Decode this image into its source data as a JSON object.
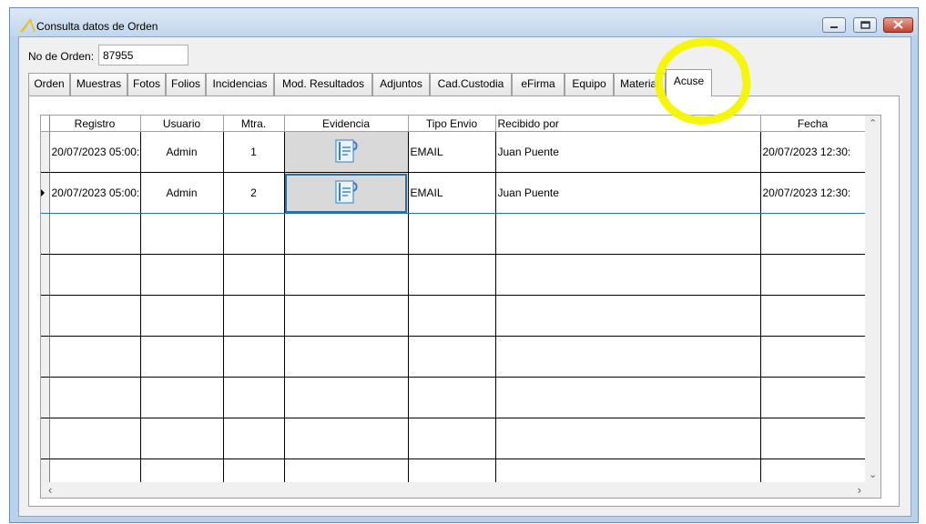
{
  "window": {
    "title": "Consulta datos de Orden",
    "icons": {
      "app": "app-logo-icon",
      "minimize": "minimize-icon",
      "maximize": "maximize-icon",
      "close": "close-icon"
    },
    "colors": {
      "highlight": "#f6f600",
      "selection": "#2a6fa8",
      "close_button": "#c14531"
    }
  },
  "order": {
    "label": "No de Orden:",
    "value": "87955"
  },
  "tabs": [
    {
      "label": "Orden"
    },
    {
      "label": "Muestras"
    },
    {
      "label": "Fotos"
    },
    {
      "label": "Folios"
    },
    {
      "label": "Incidencias"
    },
    {
      "label": "Mod. Resultados"
    },
    {
      "label": "Adjuntos"
    },
    {
      "label": "Cad.Custodia"
    },
    {
      "label": "eFirma"
    },
    {
      "label": "Equipo"
    },
    {
      "label": "Material"
    },
    {
      "label": "Acuse",
      "active": true
    }
  ],
  "grid": {
    "columns": [
      "Registro",
      "Usuario",
      "Mtra.",
      "Evidencia",
      "Tipo Envio",
      "Recibido por",
      "Fecha"
    ],
    "rows": [
      {
        "registro": "20/07/2023 05:00:",
        "usuario": "Admin",
        "mtra": "1",
        "evidencia_icon": "document-evidence-icon",
        "tipo_envio": "EMAIL",
        "recibido_por": "Juan Puente",
        "fecha": "20/07/2023 12:30:"
      },
      {
        "registro": "20/07/2023 05:00:",
        "usuario": "Admin",
        "mtra": "2",
        "evidencia_icon": "document-evidence-icon",
        "tipo_envio": "EMAIL",
        "recibido_por": "Juan Puente",
        "fecha": "20/07/2023 12:30:",
        "selected": true
      }
    ],
    "empty_rows": 7
  }
}
